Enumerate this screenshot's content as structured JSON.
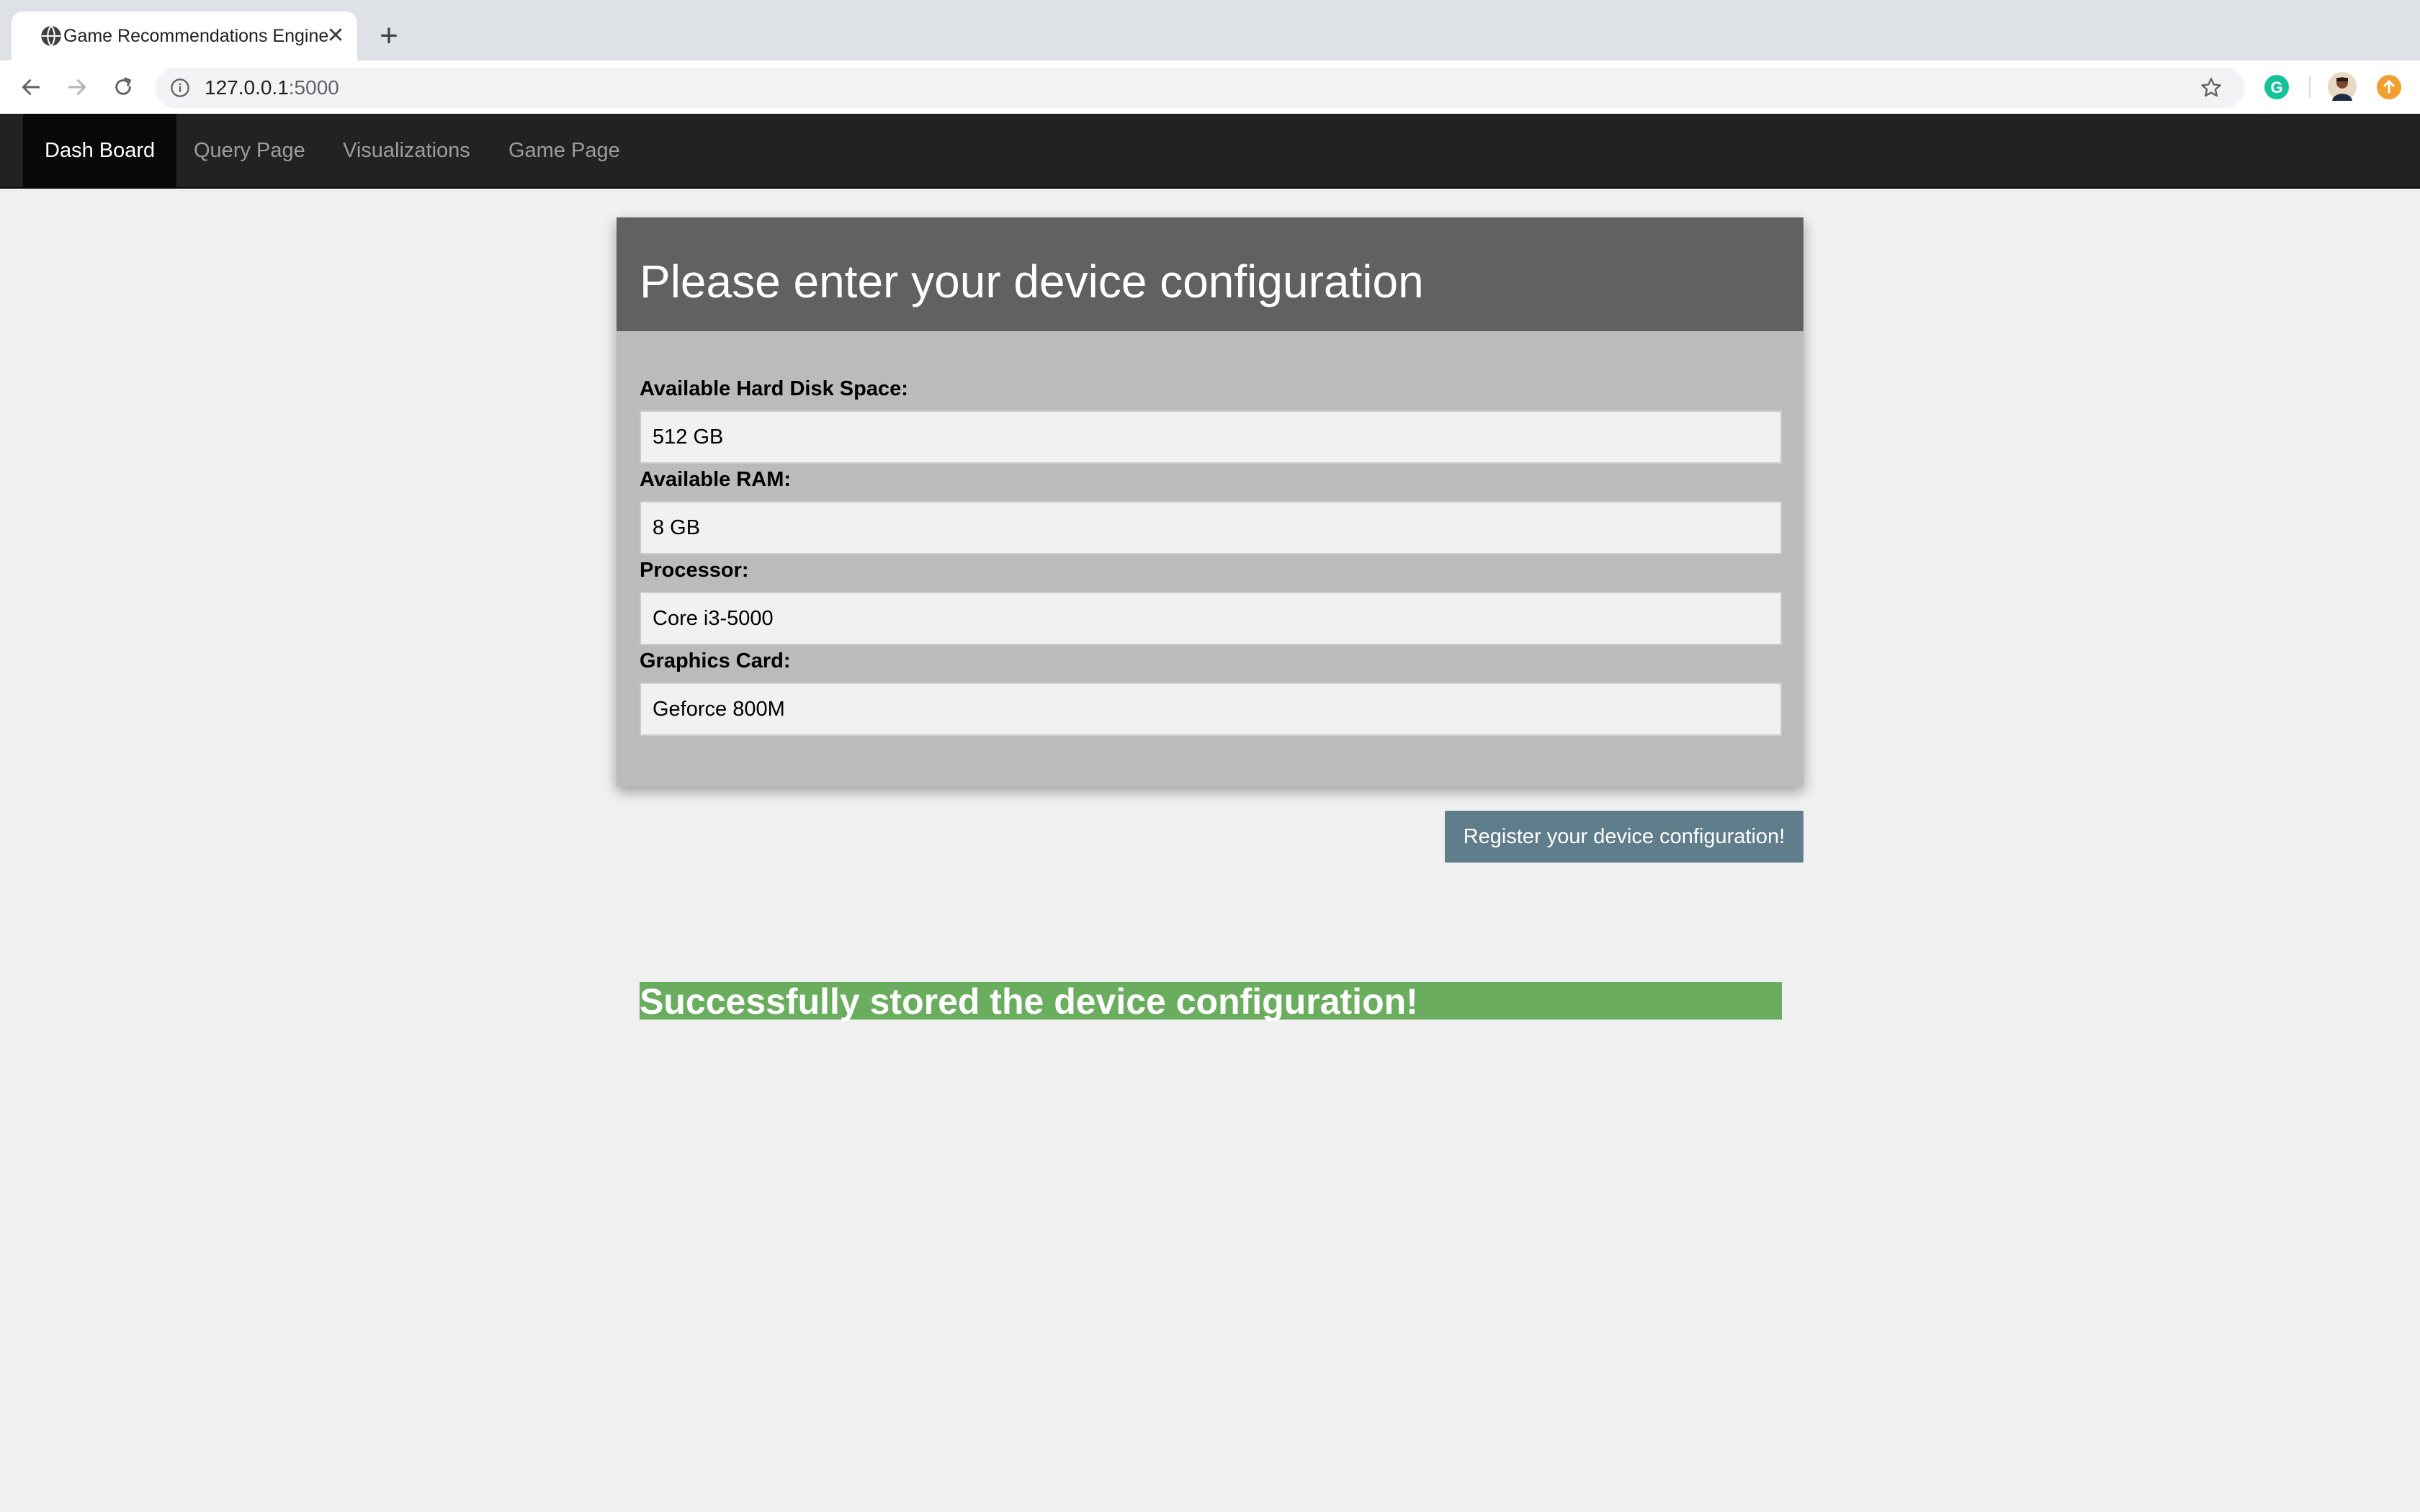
{
  "browser": {
    "tab_title": "Game Recommendations Engine",
    "url_host": "127.0.0.1",
    "url_port": ":5000"
  },
  "navbar": {
    "items": [
      {
        "label": "Dash Board",
        "active": true
      },
      {
        "label": "Query Page",
        "active": false
      },
      {
        "label": "Visualizations",
        "active": false
      },
      {
        "label": "Game Page",
        "active": false
      }
    ]
  },
  "form": {
    "title": "Please enter your device configuration",
    "fields": [
      {
        "label": "Available Hard Disk Space:",
        "value": "512 GB"
      },
      {
        "label": "Available RAM:",
        "value": "8 GB"
      },
      {
        "label": "Processor:",
        "value": "Core i3-5000"
      },
      {
        "label": "Graphics Card:",
        "value": "Geforce 800M"
      }
    ],
    "submit_label": "Register your device configuration!"
  },
  "status": {
    "message": "Successfully stored the device configuration!"
  },
  "colors": {
    "navbar_bg": "#222222",
    "card_header_bg": "#616161",
    "card_body_bg": "#bbbbbb",
    "button_bg": "#607d8b",
    "success_bg": "#6aad5e"
  }
}
